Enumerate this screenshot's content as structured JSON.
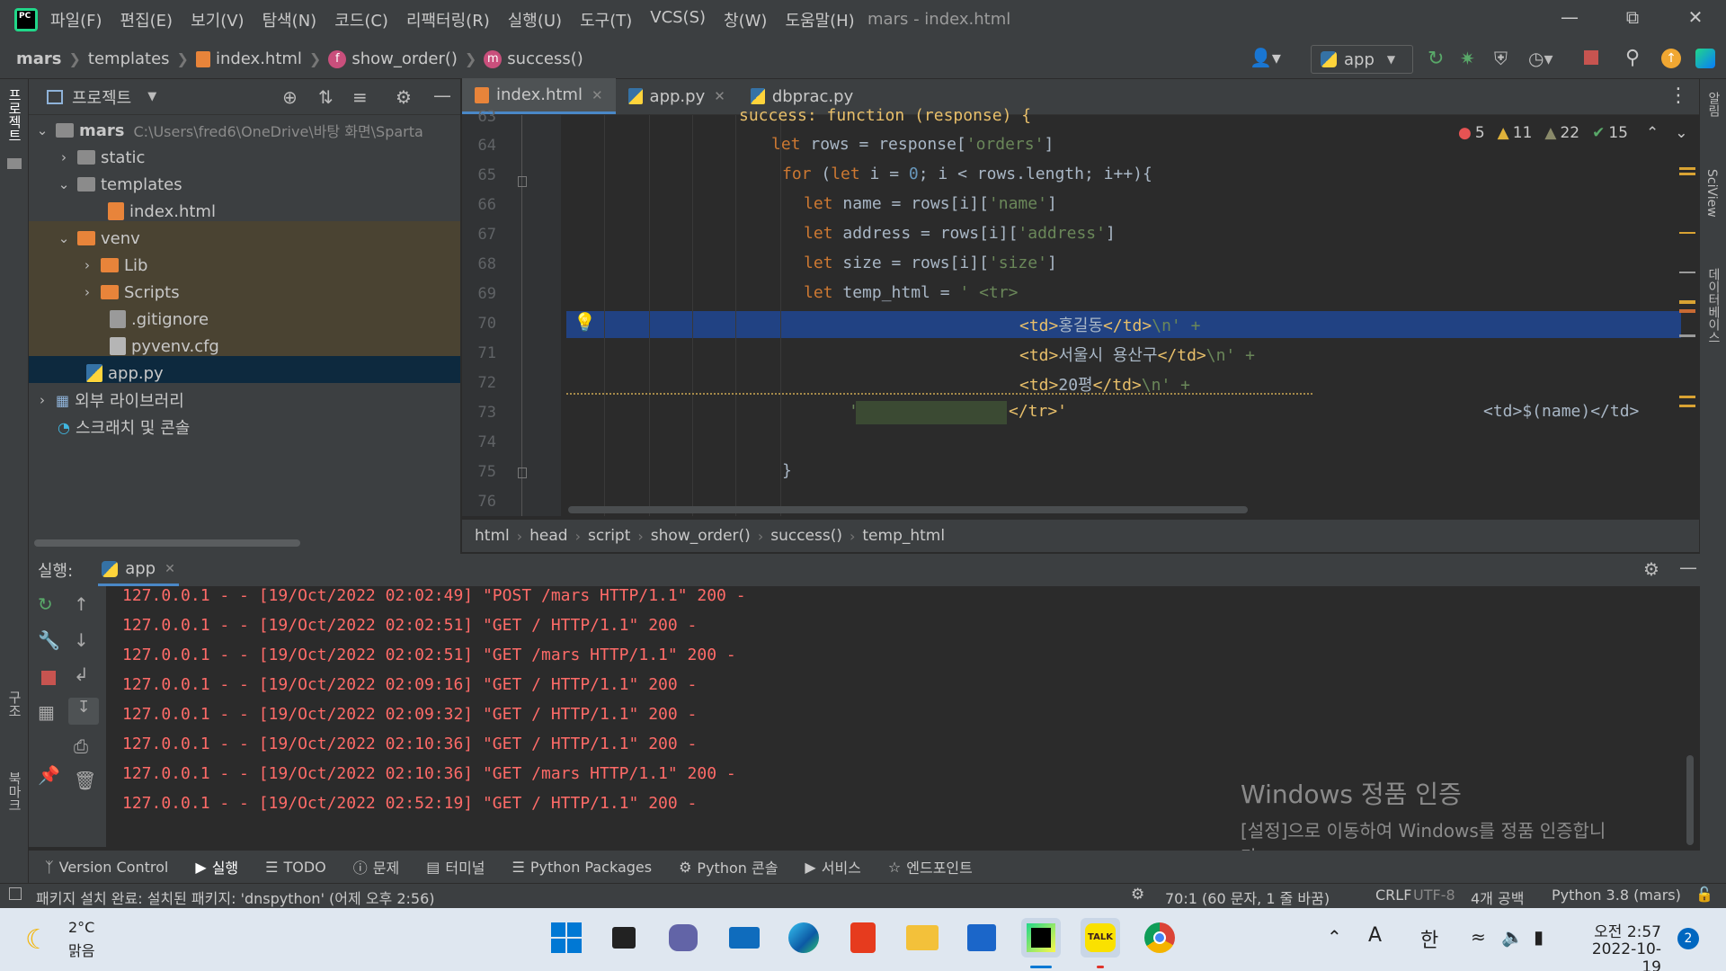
{
  "window": {
    "title": "mars - index.html",
    "menu": [
      "파일(F)",
      "편집(E)",
      "보기(V)",
      "탐색(N)",
      "코드(C)",
      "리팩터링(R)",
      "실행(U)",
      "도구(T)",
      "VCS(S)",
      "창(W)",
      "도움말(H)"
    ]
  },
  "navbar": {
    "project": "mars",
    "folder": "templates",
    "file": "index.html",
    "fn1": "show_order()",
    "fn2": "success()",
    "run_config": "app"
  },
  "side_labels": {
    "project": "프로젝트",
    "structure": "구조",
    "bookmarks": "북마크",
    "notifications": "알림",
    "sciview": "SciView",
    "database": "데이터베이스"
  },
  "project_panel": {
    "title": "프로젝트",
    "root_name": "mars",
    "root_path": "C:\\Users\\fred6\\OneDrive\\바탕 화면\\Sparta",
    "items": [
      "static",
      "templates",
      "index.html",
      "venv",
      "Lib",
      "Scripts",
      ".gitignore",
      "pyvenv.cfg",
      "app.py",
      "외부 라이브러리",
      "스크래치 및 콘솔"
    ]
  },
  "tabs": [
    {
      "label": "index.html"
    },
    {
      "label": "app.py"
    },
    {
      "label": "dbprac.py"
    }
  ],
  "inspections": {
    "errors": "5",
    "warnings": "11",
    "weak": "22",
    "ok": "15"
  },
  "code": {
    "line_numbers": [
      "63",
      "64",
      "65",
      "66",
      "67",
      "68",
      "69",
      "70",
      "71",
      "72",
      "73",
      "74",
      "75",
      "76"
    ],
    "l63": "success: function (response) {",
    "l64_kw": "let",
    "l64_a": " rows = response[",
    "l64_s": "'orders'",
    "l64_b": "]",
    "l65_kw": "for",
    "l65_a": " (",
    "l65_kw2": "let",
    "l65_b": " i = ",
    "l65_n": "0",
    "l65_c": "; i < rows.length; i++){",
    "l66_kw": "let",
    "l66_a": " name = rows[i][",
    "l66_s": "'name'",
    "l66_b": "]",
    "l67_kw": "let",
    "l67_a": " address = rows[i][",
    "l67_s": "'address'",
    "l67_b": "]",
    "l68_kw": "let",
    "l68_a": " size = rows[i][",
    "l68_s": "'size'",
    "l68_b": "]",
    "l69_kw": "let",
    "l69_a": " temp_html = ",
    "l69_s": "' <tr>",
    "l70_t1": "<td>",
    "l70_txt": "홍길동",
    "l70_t2": "</td>",
    "l70_e": "\\n' +",
    "l71_t1": "<td>",
    "l71_txt": "서울시 용산구",
    "l71_t2": "</td>",
    "l71_e": "\\n' +",
    "l72_t1": "<td>",
    "l72_txt": "20평",
    "l72_t2": "</td>",
    "l72_e": "\\n' +",
    "l73_q": "'",
    "l73_t": "</tr>'",
    "l73_hint": "<td>$(name)</td>",
    "l75": "}"
  },
  "editor_crumbs": [
    "html",
    "head",
    "script",
    "show_order()",
    "success()",
    "temp_html"
  ],
  "run": {
    "label": "실행:",
    "tab": "app",
    "logs": [
      "127.0.0.1 - - [19/Oct/2022 02:02:49] \"POST /mars HTTP/1.1\" 200 -",
      "127.0.0.1 - - [19/Oct/2022 02:02:51] \"GET / HTTP/1.1\" 200 -",
      "127.0.0.1 - - [19/Oct/2022 02:02:51] \"GET /mars HTTP/1.1\" 200 -",
      "127.0.0.1 - - [19/Oct/2022 02:09:16] \"GET / HTTP/1.1\" 200 -",
      "127.0.0.1 - - [19/Oct/2022 02:09:32] \"GET / HTTP/1.1\" 200 -",
      "127.0.0.1 - - [19/Oct/2022 02:10:36] \"GET / HTTP/1.1\" 200 -",
      "127.0.0.1 - - [19/Oct/2022 02:10:36] \"GET /mars HTTP/1.1\" 200 -",
      "127.0.0.1 - - [19/Oct/2022 02:52:19] \"GET / HTTP/1.1\" 200 -"
    ]
  },
  "toolwindows": [
    "Version Control",
    "실행",
    "TODO",
    "문제",
    "터미널",
    "Python Packages",
    "Python 콘솔",
    "서비스",
    "엔드포인트"
  ],
  "status": {
    "message": "패키지 설치 완료: 설치된 패키지: 'dnspython' (어제 오후 2:56)",
    "position": "70:1 (60 문자, 1 줄 바꿈)",
    "line_sep": "CRLF",
    "encoding": "UTF-8",
    "indent": "4개 공백",
    "interpreter": "Python 3.8 (mars)"
  },
  "watermark": {
    "title": "Windows 정품 인증",
    "line1": "[설정]으로 이동하여 Windows를 정품 인증합니",
    "line2": "다."
  },
  "taskbar": {
    "weather_temp": "2°C",
    "weather_desc": "맑음",
    "ime_a": "A",
    "ime_han": "한",
    "time": "오전 2:57",
    "date": "2022-10-19",
    "notif_count": "2"
  },
  "colors": {
    "accent": "#4a88c7",
    "selection": "#214283",
    "log_text": "#ff6b68",
    "keyword": "#cc7832",
    "string": "#6a8759"
  }
}
